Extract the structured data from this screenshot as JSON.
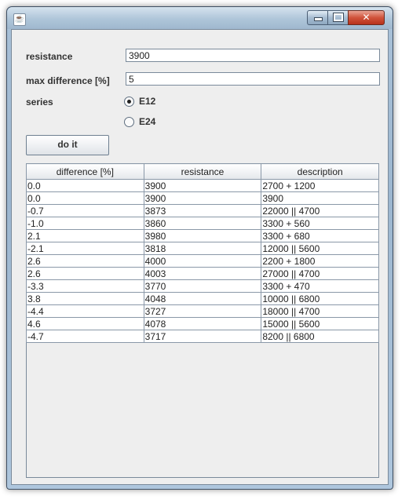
{
  "window": {
    "title": ""
  },
  "form": {
    "resistance_label": "resistance",
    "resistance_value": "3900",
    "maxdiff_label": "max difference [%]",
    "maxdiff_value": "5",
    "series_label": "series",
    "series_options": [
      {
        "label": "E12",
        "selected": true
      },
      {
        "label": "E24",
        "selected": false
      }
    ],
    "button_label": "do it"
  },
  "table": {
    "columns": [
      "difference [%]",
      "resistance",
      "description"
    ],
    "rows": [
      [
        "0.0",
        "3900",
        "2700 + 1200"
      ],
      [
        "0.0",
        "3900",
        "3900"
      ],
      [
        "-0.7",
        "3873",
        "22000 || 4700"
      ],
      [
        "-1.0",
        "3860",
        "3300 + 560"
      ],
      [
        "2.1",
        "3980",
        "3300 + 680"
      ],
      [
        "-2.1",
        "3818",
        "12000 || 5600"
      ],
      [
        "2.6",
        "4000",
        "2200 + 1800"
      ],
      [
        "2.6",
        "4003",
        "27000 || 4700"
      ],
      [
        "-3.3",
        "3770",
        "3300 + 470"
      ],
      [
        "3.8",
        "4048",
        "10000 || 6800"
      ],
      [
        "-4.4",
        "3727",
        "18000 || 4700"
      ],
      [
        "4.6",
        "4078",
        "15000 || 5600"
      ],
      [
        "-4.7",
        "3717",
        "8200 || 6800"
      ]
    ]
  }
}
